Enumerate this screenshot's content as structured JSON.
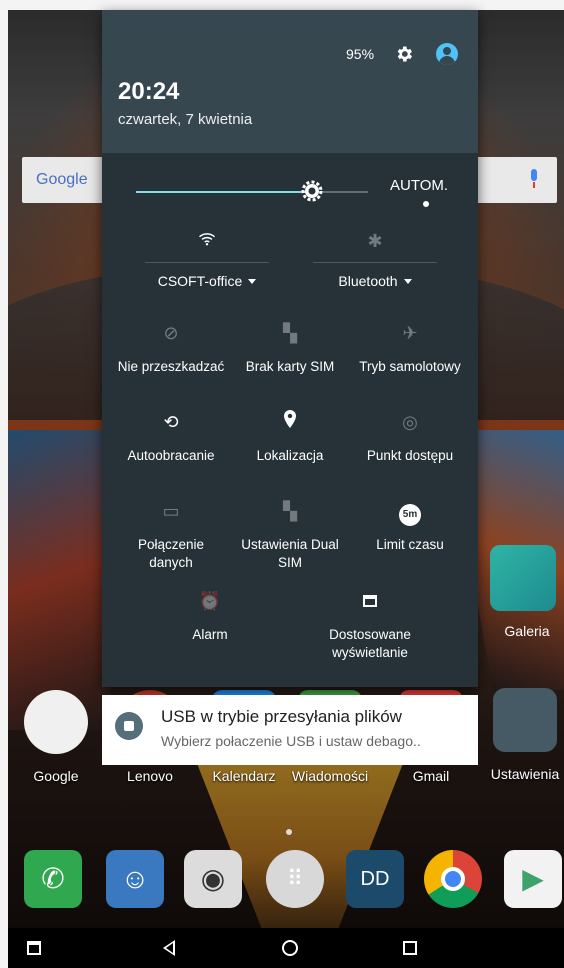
{
  "status": {
    "battery": "95%"
  },
  "header": {
    "time": "20:24",
    "date": "czwartek, 7 kwietnia"
  },
  "brightness": {
    "level_fraction": 0.76,
    "auto_label": "AUTOM."
  },
  "wifi": {
    "label": "CSOFT-office",
    "icon": "wifi-icon"
  },
  "bluetooth": {
    "label": "Bluetooth",
    "icon": "bluetooth-icon"
  },
  "tiles": [
    {
      "label": "Nie przeszkadzać",
      "icon": "dnd-icon"
    },
    {
      "label": "Brak karty SIM",
      "icon": "no-sim-icon"
    },
    {
      "label": "Tryb samolotowy",
      "icon": "airplane-icon"
    },
    {
      "label": "Autoobracanie",
      "icon": "rotate-icon"
    },
    {
      "label": "Lokalizacja",
      "icon": "location-icon"
    },
    {
      "label": "Punkt dostępu",
      "icon": "hotspot-icon"
    },
    {
      "label": "Połączenie\ndanych",
      "icon": "data-icon"
    },
    {
      "label": "Ustawienia Dual\nSIM",
      "icon": "dual-sim-icon"
    },
    {
      "label": "Limit czasu",
      "icon": "timeout-icon",
      "badge": "5m"
    },
    {
      "label": "Alarm",
      "icon": "alarm-icon"
    },
    {
      "label": "Dostosowane\nwyświetlanie",
      "icon": "display-icon"
    }
  ],
  "notification": {
    "title": "USB w trybie przesyłania plików",
    "text": "Wybierz połaczenie USB i ustaw debago.."
  },
  "home": {
    "search_logo": "Google",
    "apps": [
      "Google",
      "Lenovo",
      "Kalendarz",
      "Wiadomości",
      "Gmail",
      "Ustawienia"
    ],
    "galeria": "Galeria"
  }
}
